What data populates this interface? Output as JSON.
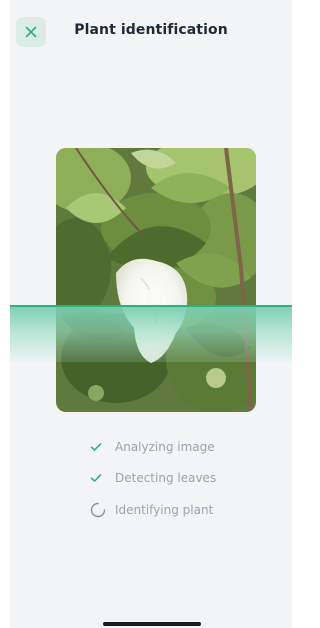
{
  "header": {
    "title": "Plant identification",
    "close_icon": "close-icon"
  },
  "colors": {
    "accent": "#2fae86",
    "background": "#f2f4f6",
    "close_button_bg": "#dbece7",
    "step_text": "#9aa3ad"
  },
  "progress": {
    "steps": [
      {
        "label": "Analyzing image",
        "status": "done",
        "icon": "check-icon"
      },
      {
        "label": "Detecting leaves",
        "status": "done",
        "icon": "check-icon"
      },
      {
        "label": "Identifying plant",
        "status": "in-progress",
        "icon": "spinner-icon"
      }
    ]
  }
}
